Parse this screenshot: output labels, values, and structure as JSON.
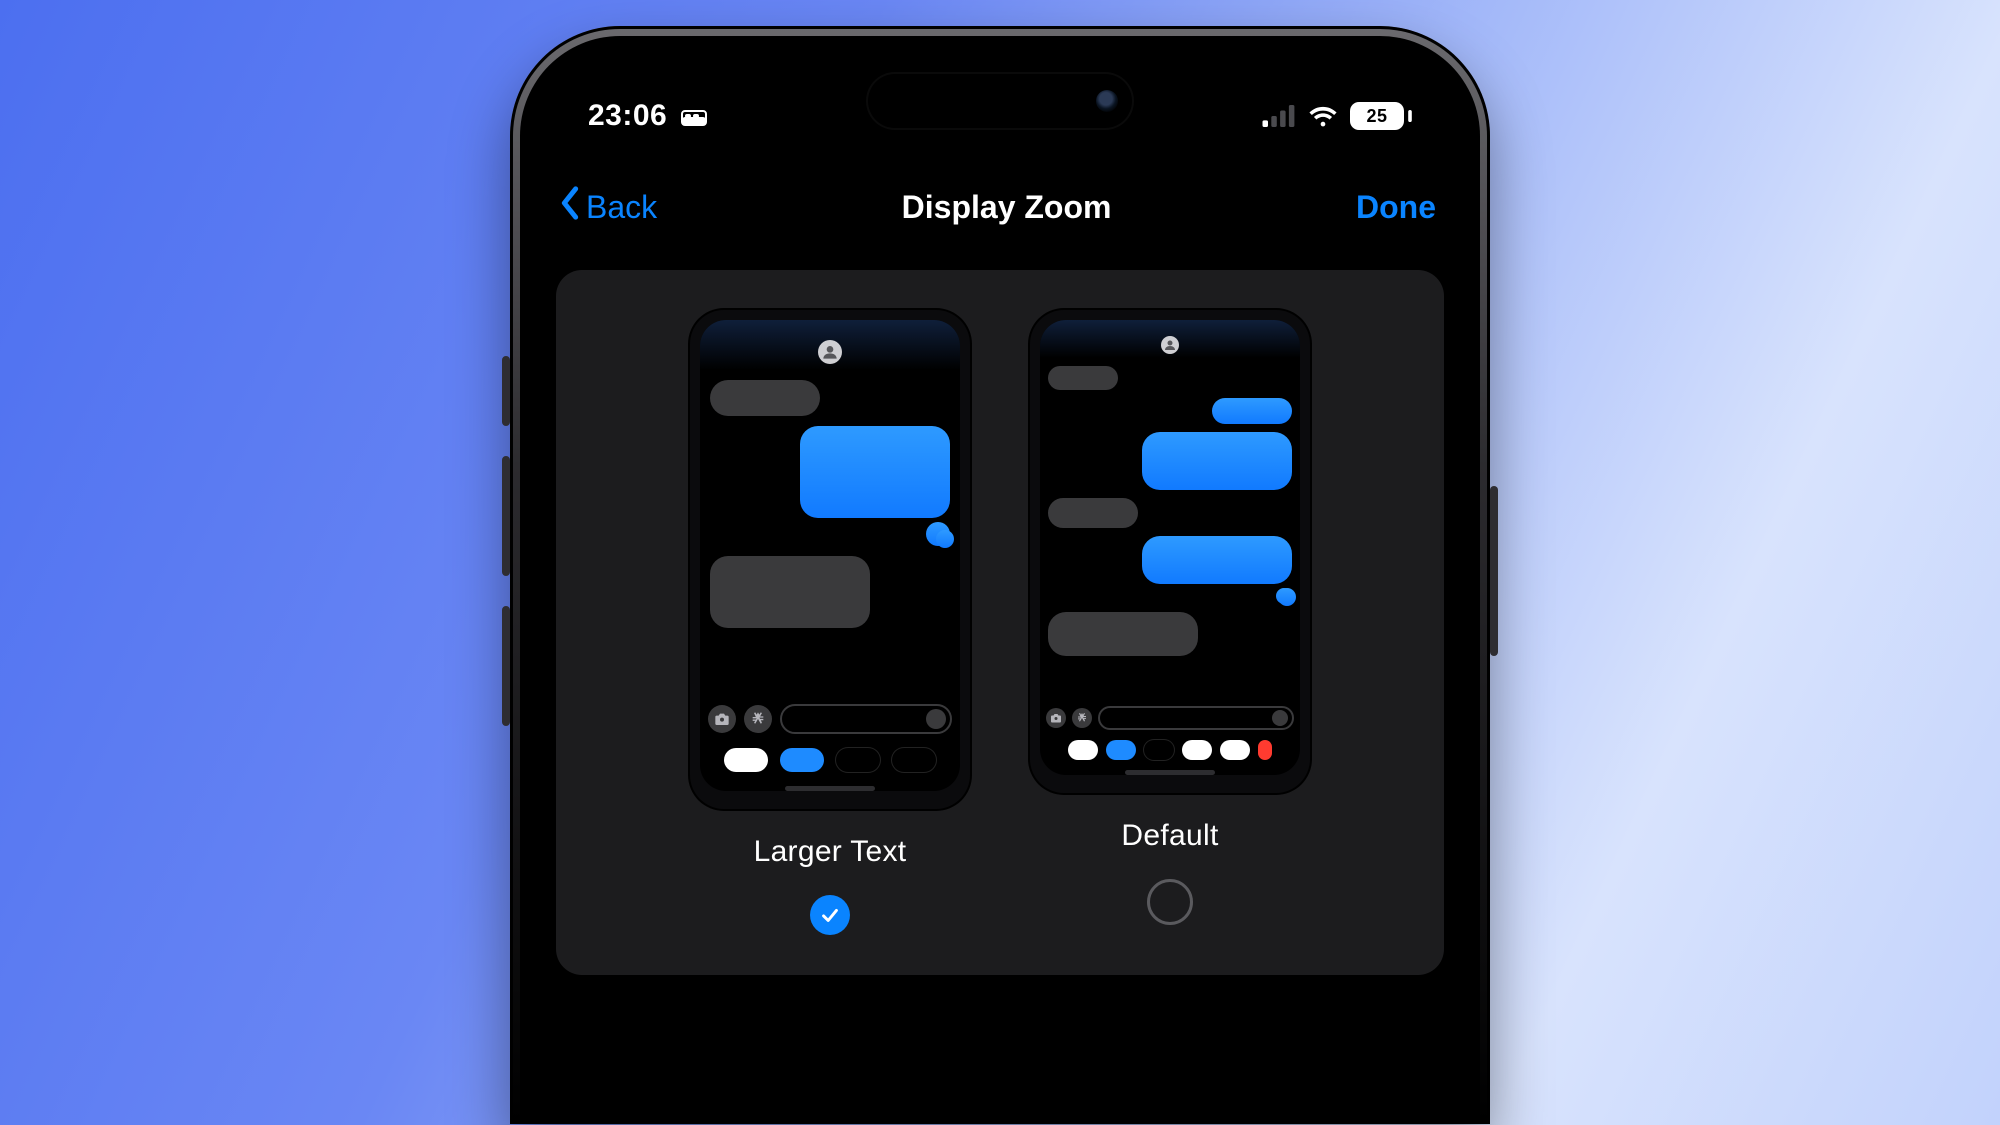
{
  "status": {
    "time": "23:06",
    "focus_icon": "sleep-focus-icon",
    "battery_percent": "25"
  },
  "nav": {
    "back_label": "Back",
    "title": "Display Zoom",
    "done_label": "Done"
  },
  "options": [
    {
      "id": "larger-text",
      "label": "Larger Text",
      "selected": true
    },
    {
      "id": "default",
      "label": "Default",
      "selected": false
    }
  ],
  "colors": {
    "ios_blue": "#0a84ff",
    "bubble_blue": "#1e8bff",
    "bubble_grey": "#3a3a3c"
  }
}
